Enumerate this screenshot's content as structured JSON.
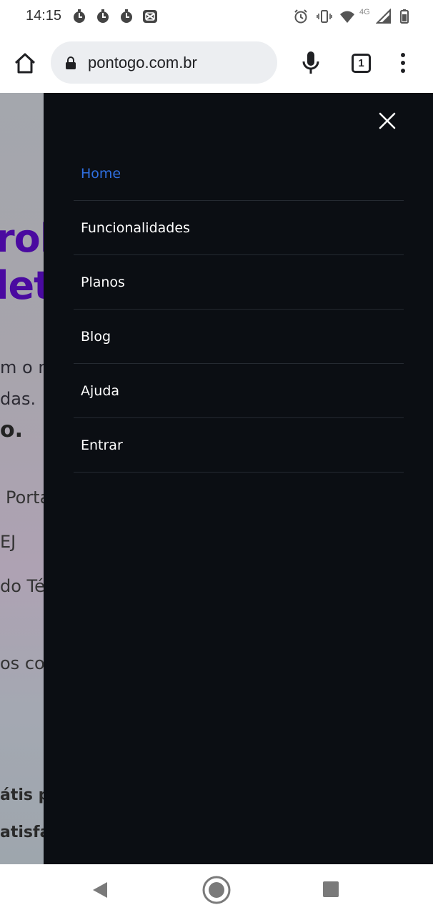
{
  "status_bar": {
    "time": "14:15",
    "network": "4G",
    "icons": [
      "notification-circle-icon",
      "notification-circle-icon",
      "notification-circle-icon",
      "capcut-icon",
      "alarm-icon",
      "vibrate-icon",
      "wifi-icon",
      "cell-signal-icon",
      "battery-icon"
    ]
  },
  "browser": {
    "url": "pontogo.com.br",
    "tab_count": "1",
    "icons": [
      "home-icon",
      "lock-icon",
      "mic-icon",
      "tabs-icon",
      "more-vert-icon"
    ]
  },
  "page": {
    "hero_line1": "rol",
    "hero_line2": "let",
    "sub_line1": "m o n",
    "sub_line2": "das.",
    "sub_bold": "o.",
    "item1": "Porta",
    "item2": "EJ",
    "item3": "do Téc",
    "item4": "os co",
    "bold1": "átis p",
    "bold2": "atisfa",
    "hero_color": "#4a0aa0"
  },
  "drawer": {
    "close_icon": "close-icon",
    "items": [
      {
        "label": "Home",
        "active": true
      },
      {
        "label": "Funcionalidades",
        "active": false
      },
      {
        "label": "Planos",
        "active": false
      },
      {
        "label": "Blog",
        "active": false
      },
      {
        "label": "Ajuda",
        "active": false
      },
      {
        "label": "Entrar",
        "active": false
      }
    ],
    "background": "#0b0e13",
    "active_color": "#2f6fe0"
  },
  "system_nav": {
    "icons": [
      "back-icon",
      "home-circle-icon",
      "recents-icon"
    ]
  }
}
